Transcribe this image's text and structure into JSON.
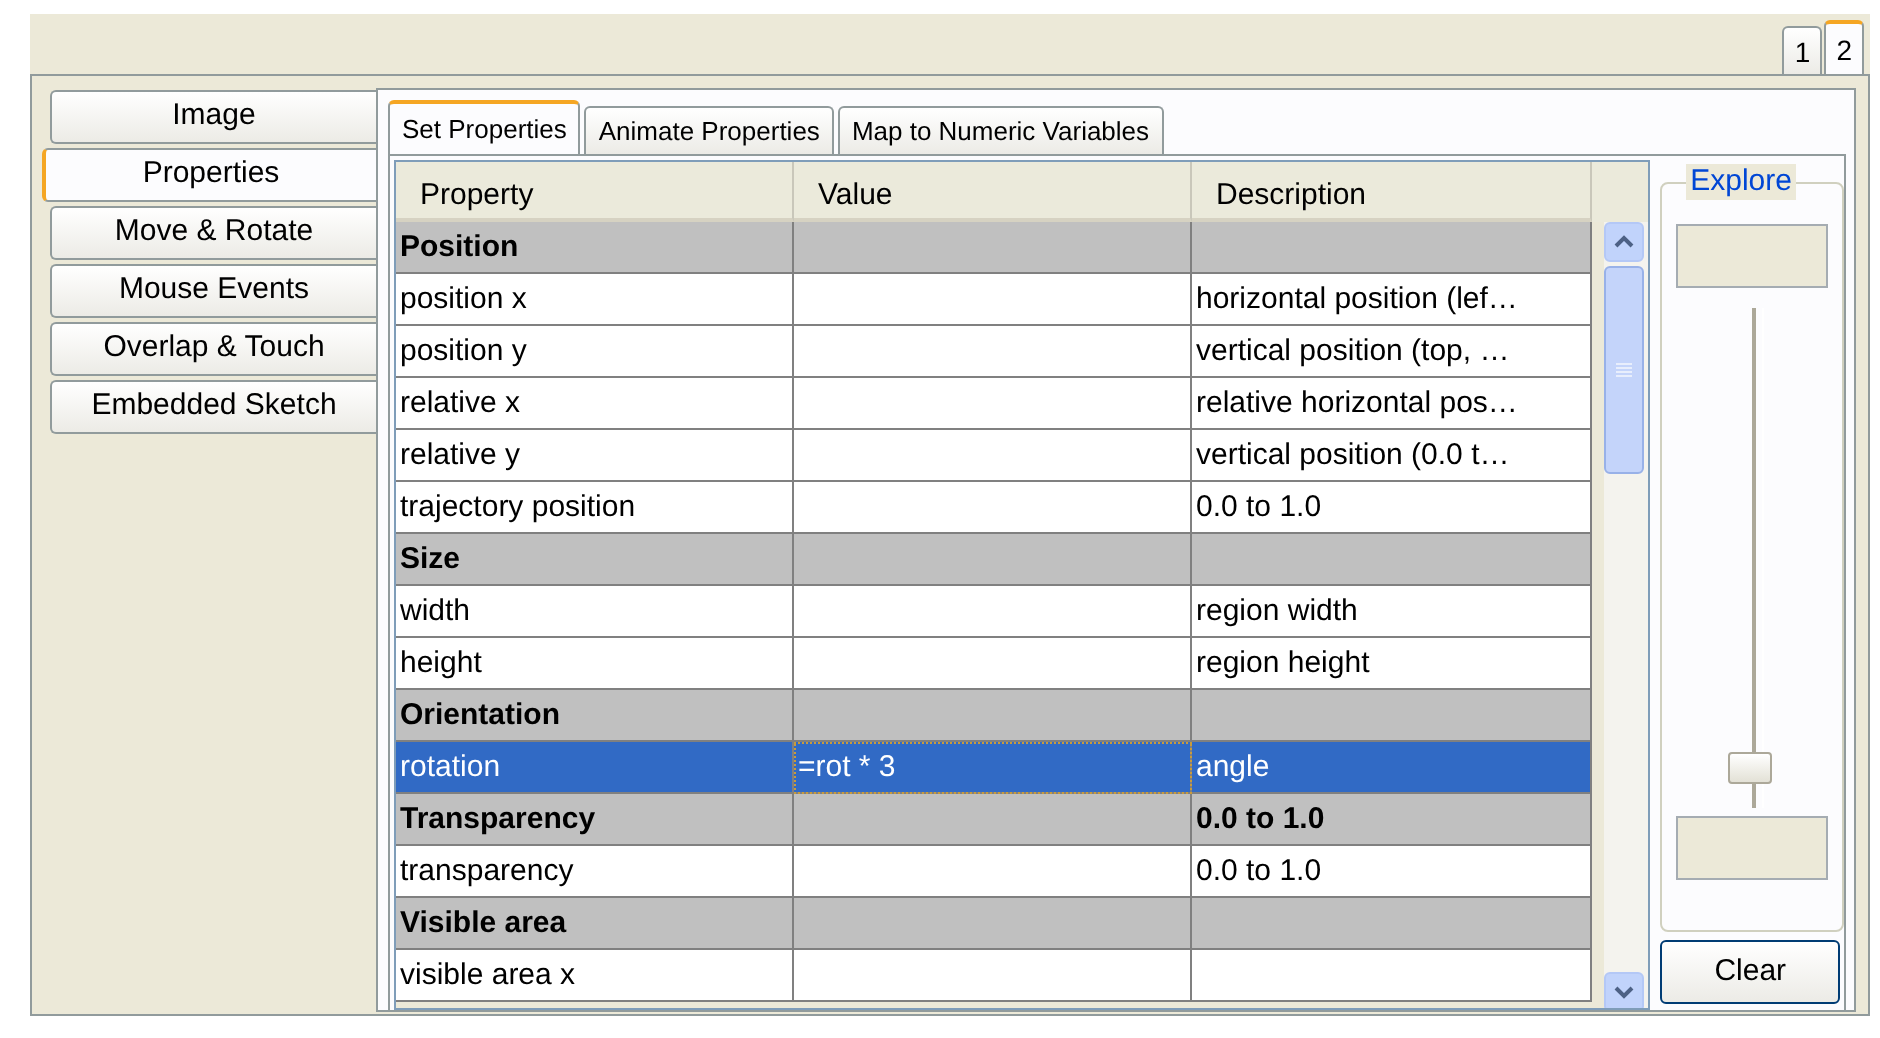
{
  "page_tabs": [
    {
      "label": "1",
      "selected": false
    },
    {
      "label": "2",
      "selected": true
    }
  ],
  "side_tabs": [
    {
      "label": "Image",
      "selected": false
    },
    {
      "label": "Properties",
      "selected": true
    },
    {
      "label": "Move & Rotate",
      "selected": false
    },
    {
      "label": "Mouse Events",
      "selected": false
    },
    {
      "label": "Overlap & Touch",
      "selected": false
    },
    {
      "label": "Embedded Sketch",
      "selected": false
    }
  ],
  "tabs": [
    {
      "label": "Set Properties",
      "selected": true
    },
    {
      "label": "Animate Properties",
      "selected": false
    },
    {
      "label": "Map to Numeric Variables",
      "selected": false
    }
  ],
  "table": {
    "columns": [
      "Property",
      "Value",
      "Description"
    ],
    "rows": [
      {
        "kind": "group",
        "property": "Position",
        "selected": false
      },
      {
        "kind": "item",
        "property": "position x",
        "description": "horizontal position (lef…",
        "selected": false
      },
      {
        "kind": "item",
        "property": "position y",
        "description": "vertical position (top, …",
        "selected": false
      },
      {
        "kind": "item",
        "property": "relative x",
        "description": "relative horizontal pos…",
        "selected": false
      },
      {
        "kind": "item",
        "property": "relative y",
        "description": "vertical position (0.0 t…",
        "selected": false
      },
      {
        "kind": "item",
        "property": "trajectory position",
        "description": "0.0 to 1.0",
        "selected": false
      },
      {
        "kind": "group",
        "property": "Size",
        "selected": false
      },
      {
        "kind": "item",
        "property": "width",
        "description": "region width",
        "selected": false
      },
      {
        "kind": "item",
        "property": "height",
        "description": "region height",
        "selected": false
      },
      {
        "kind": "group",
        "property": "Orientation",
        "selected": false
      },
      {
        "kind": "item",
        "property": "rotation",
        "value": "=rot * 3",
        "description": "angle",
        "selected": true
      },
      {
        "kind": "group",
        "property": "Transparency",
        "description": "0.0 to 1.0",
        "selected": false
      },
      {
        "kind": "item",
        "property": "transparency",
        "description": "0.0 to 1.0",
        "selected": false
      },
      {
        "kind": "group",
        "property": "Visible area",
        "selected": false
      },
      {
        "kind": "item",
        "property": "visible area x",
        "selected": false
      }
    ]
  },
  "explore": {
    "title": "Explore",
    "slider": {
      "level": 0.05
    },
    "button": "Clear"
  }
}
